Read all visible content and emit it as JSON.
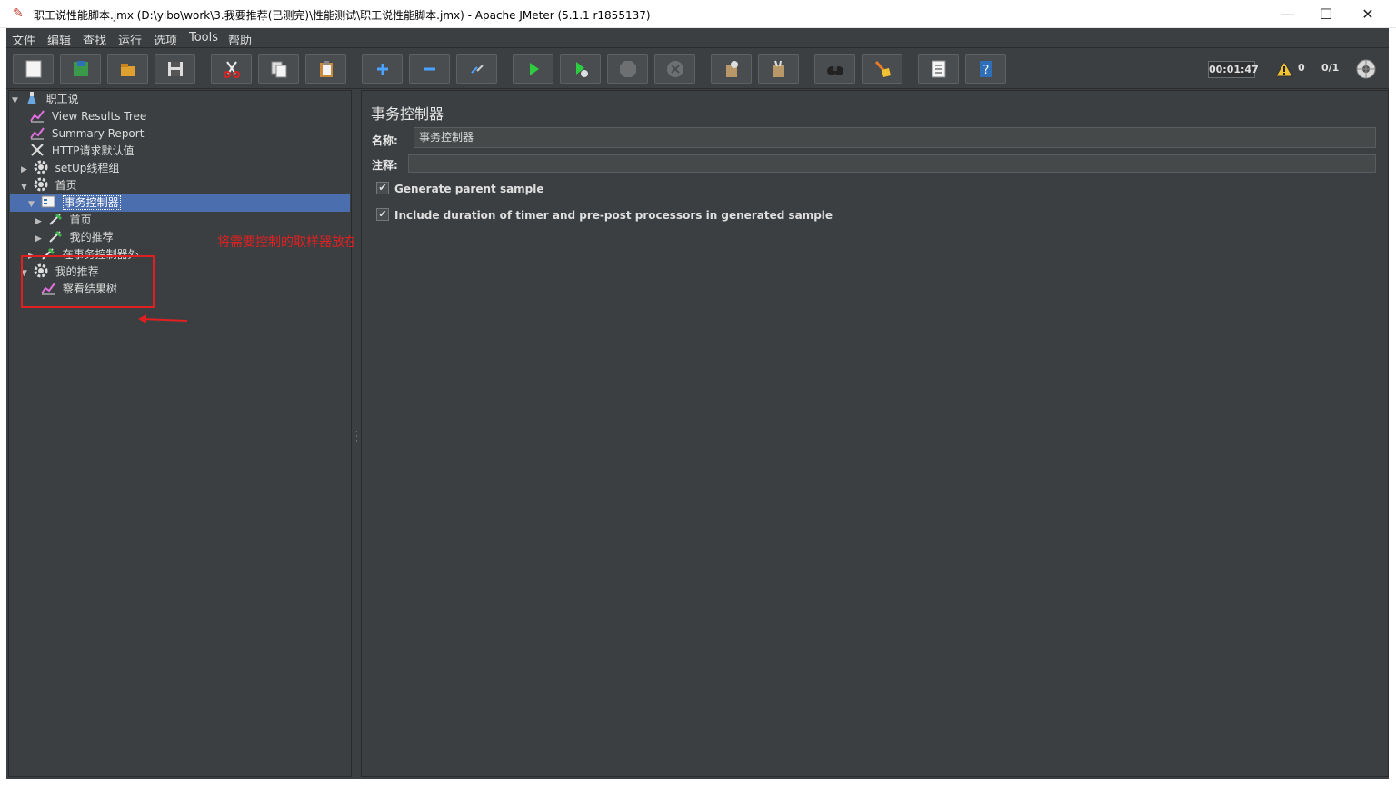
{
  "window": {
    "title": "职工说性能脚本.jmx (D:\\yibo\\work\\3.我要推荐(已测完)\\性能测试\\职工说性能脚本.jmx) - Apache JMeter (5.1.1 r1855137)",
    "app_icon": "feather-icon",
    "minimize_glyph": "—",
    "maximize_glyph": "☐",
    "close_glyph": "✕"
  },
  "menu": {
    "items": [
      "文件",
      "编辑",
      "查找",
      "运行",
      "选项",
      "Tools",
      "帮助"
    ]
  },
  "toolbar": {
    "buttons": [
      {
        "name": "new",
        "icon": "new-file-icon"
      },
      {
        "name": "templates",
        "icon": "templates-icon"
      },
      {
        "name": "open",
        "icon": "open-folder-icon"
      },
      {
        "name": "save",
        "icon": "save-icon"
      },
      {
        "name": "cut",
        "icon": "cut-icon"
      },
      {
        "name": "copy",
        "icon": "copy-icon"
      },
      {
        "name": "paste",
        "icon": "paste-icon"
      },
      {
        "name": "expand",
        "icon": "plus-icon"
      },
      {
        "name": "collapse",
        "icon": "minus-icon"
      },
      {
        "name": "toggle",
        "icon": "toggle-icon"
      },
      {
        "name": "start",
        "icon": "start-icon"
      },
      {
        "name": "start-no-pauses",
        "icon": "start-no-pause-icon"
      },
      {
        "name": "stop",
        "icon": "stop-icon"
      },
      {
        "name": "shutdown",
        "icon": "shutdown-icon"
      },
      {
        "name": "clear",
        "icon": "clear-icon"
      },
      {
        "name": "clear-all",
        "icon": "clear-all-icon"
      },
      {
        "name": "search",
        "icon": "binoculars-icon"
      },
      {
        "name": "reset-search",
        "icon": "broom-icon"
      },
      {
        "name": "function-helper",
        "icon": "function-list-icon"
      },
      {
        "name": "help",
        "icon": "help-icon"
      }
    ],
    "timer": "00:01:47",
    "warning_count": "0",
    "thread_count": "0/1"
  },
  "tree": {
    "nodes": [
      {
        "label": "职工说",
        "icon": "test-plan-icon",
        "arrow": "▼"
      },
      {
        "label": "View Results Tree",
        "icon": "chart-icon",
        "arrow": ""
      },
      {
        "label": "Summary Report",
        "icon": "chart-icon",
        "arrow": ""
      },
      {
        "label": "HTTP请求默认值",
        "icon": "wrench-icon",
        "arrow": ""
      },
      {
        "label": "setUp线程组",
        "icon": "gear-icon",
        "arrow": "▶"
      },
      {
        "label": "首页",
        "icon": "gear-icon",
        "arrow": "▼"
      },
      {
        "label": "事务控制器",
        "icon": "controller-icon",
        "arrow": "▼"
      },
      {
        "label": "首页",
        "icon": "sampler-icon",
        "arrow": "▶"
      },
      {
        "label": "我的推荐",
        "icon": "sampler-icon",
        "arrow": "▶"
      },
      {
        "label": "在事务控制器外",
        "icon": "sampler-icon",
        "arrow": "▶"
      },
      {
        "label": "我的推荐",
        "icon": "gear-icon",
        "arrow": "▼"
      },
      {
        "label": "察看结果树",
        "icon": "chart-icon",
        "arrow": ""
      }
    ],
    "annotation": "将需要控制的取样器放在事务控制器下"
  },
  "detail": {
    "title": "事务控制器",
    "name_label": "名称:",
    "name_value": "事务控制器",
    "comment_label": "注释:",
    "comment_value": "",
    "check1_label": "Generate parent sample",
    "check2_label": "Include duration of timer and pre-post processors in generated sample",
    "check_mark": "✔"
  },
  "colors": {
    "background": "#3c3f41",
    "selection": "#4b6eaf",
    "annotation": "#e02020"
  }
}
